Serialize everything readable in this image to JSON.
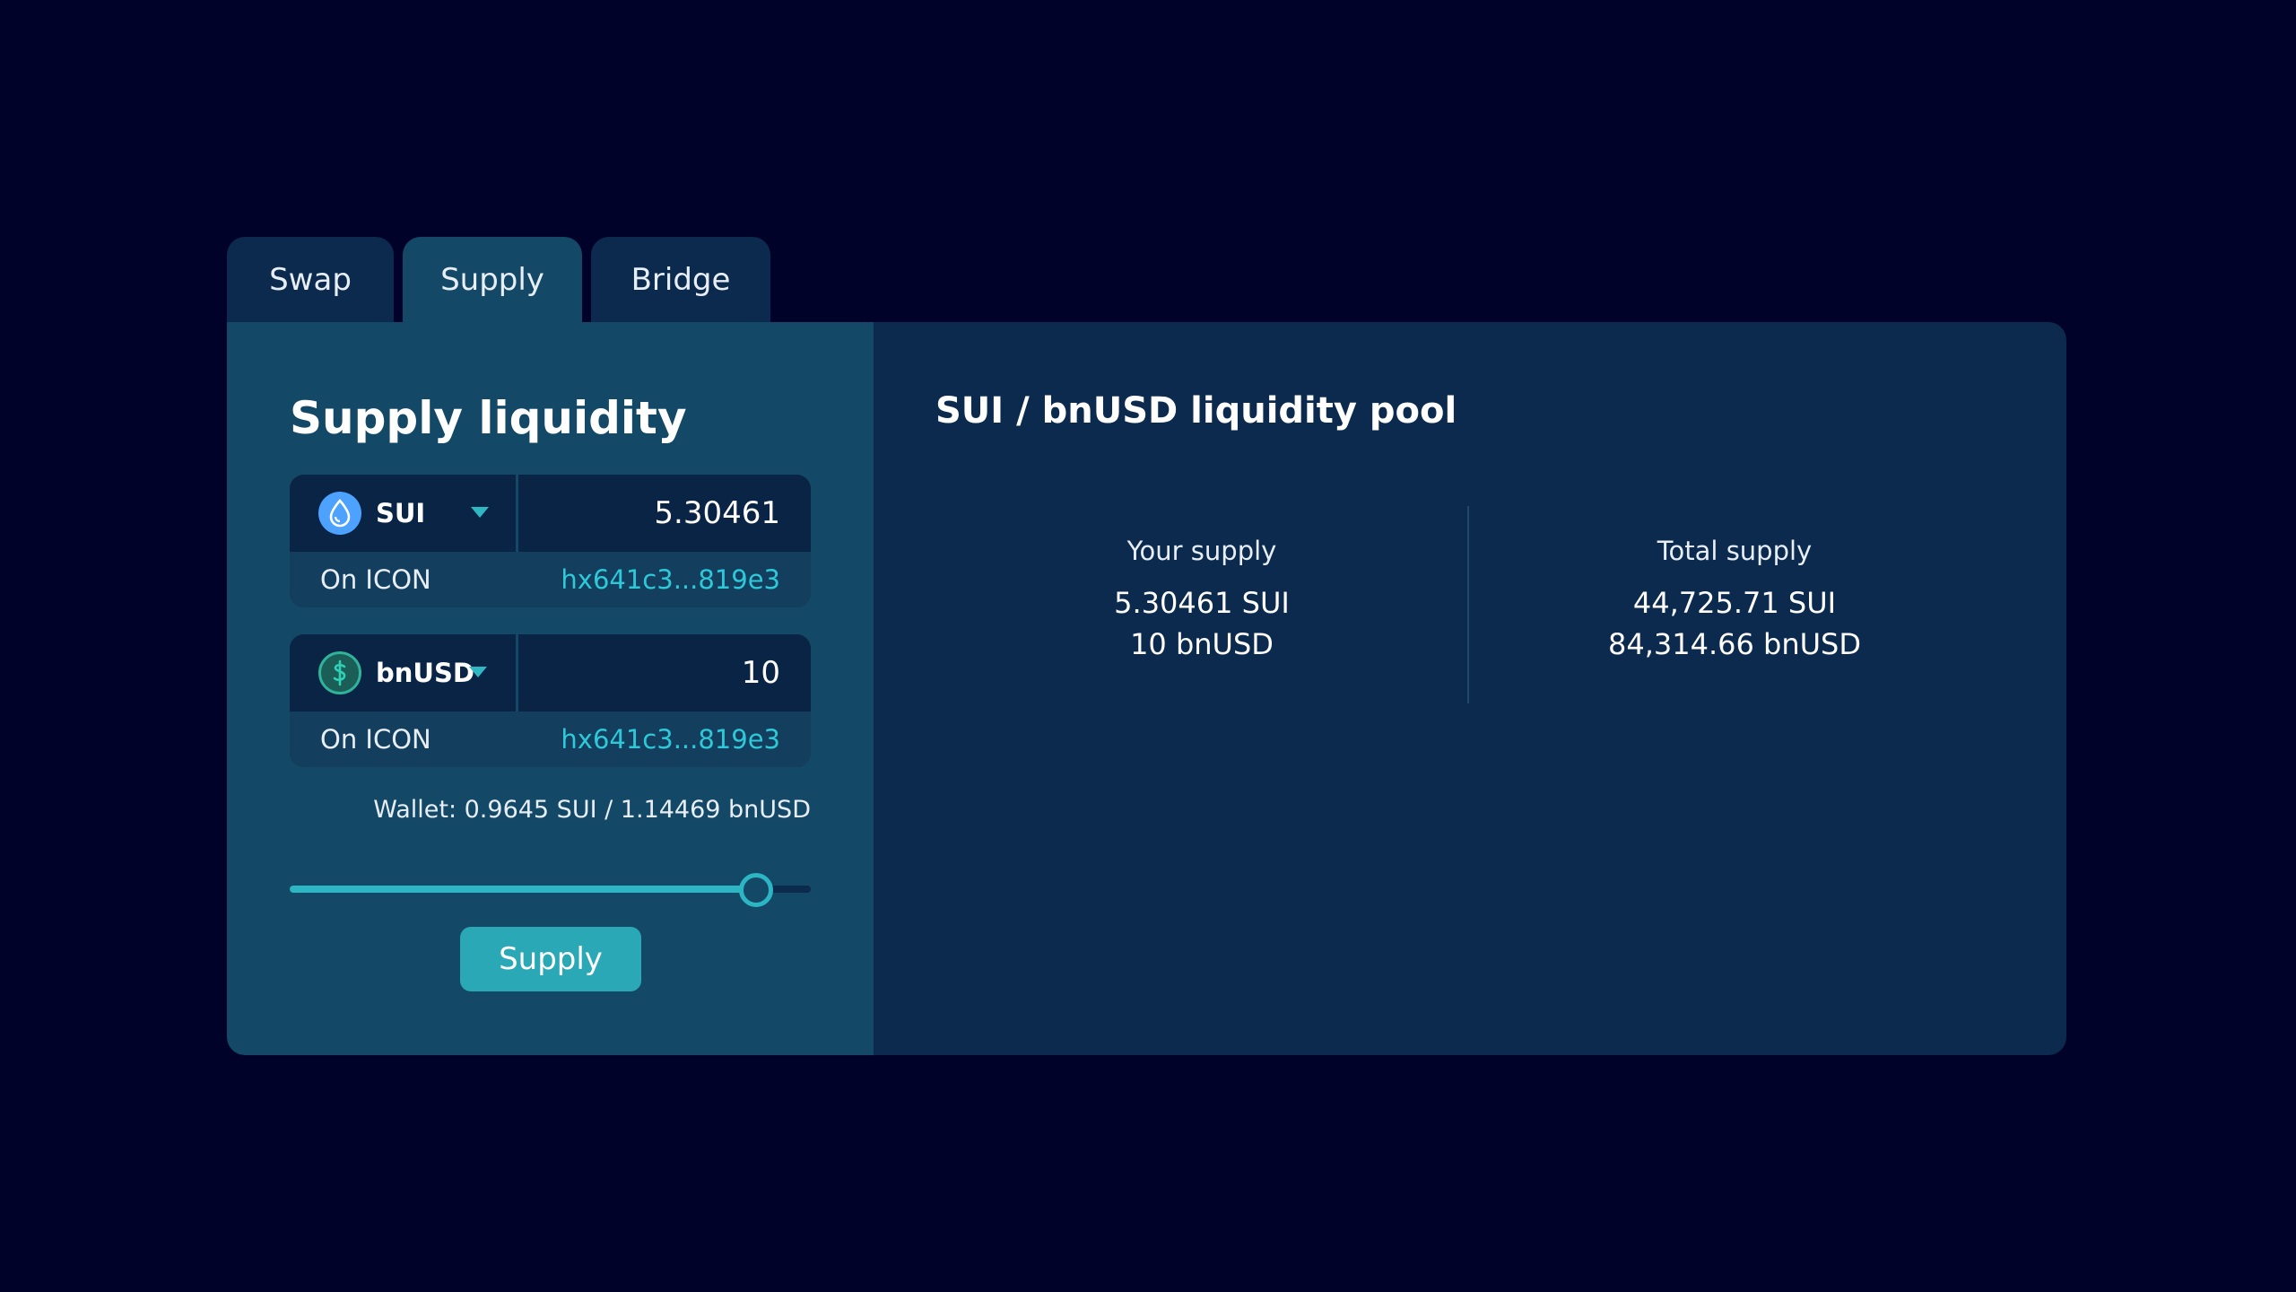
{
  "tabs": [
    {
      "label": "Swap",
      "active": false
    },
    {
      "label": "Supply",
      "active": true
    },
    {
      "label": "Bridge",
      "active": false
    }
  ],
  "supply_form": {
    "title": "Supply liquidity",
    "assets": [
      {
        "symbol": "SUI",
        "icon": "sui-droplet-icon",
        "icon_color": "#4da2ff",
        "amount": "5.30461",
        "network": "On ICON",
        "address": "hx641c3...819e3"
      },
      {
        "symbol": "bnUSD",
        "icon": "dollar-coin-icon",
        "icon_color": "#2fb39a",
        "amount": "10",
        "network": "On ICON",
        "address": "hx641c3...819e3"
      }
    ],
    "wallet": "Wallet: 0.9645 SUI / 1.14469 bnUSD",
    "slider_fraction": 0.895,
    "button_label": "Supply"
  },
  "pool": {
    "title": "SUI / bnUSD liquidity pool",
    "your_supply": {
      "label": "Your supply",
      "lines": [
        "5.30461 SUI",
        "10 bnUSD"
      ]
    },
    "total_supply": {
      "label": "Total supply",
      "lines": [
        "44,725.71 SUI",
        "84,314.66 bnUSD"
      ]
    }
  },
  "colors": {
    "background": "#01022a",
    "panel": "#0c2a4d",
    "panel_active": "#144867",
    "accent": "#2aa8b6",
    "link": "#2ec9d8"
  }
}
